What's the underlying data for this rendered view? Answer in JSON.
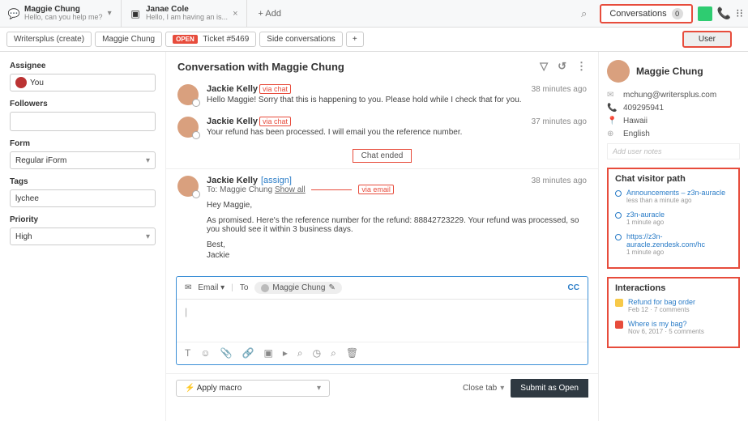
{
  "tabs": [
    {
      "title": "Maggie Chung",
      "subtitle": "Hello, can you help me?"
    },
    {
      "title": "Janae Cole",
      "subtitle": "Hello, I am having an is..."
    }
  ],
  "addTab": "+ Add",
  "topRight": {
    "conversations": "Conversations",
    "conv_count": "0"
  },
  "crumbs": {
    "org": "Writersplus (create)",
    "requester": "Maggie Chung",
    "status": "OPEN",
    "ticket": "Ticket #5469",
    "side": "Side conversations",
    "user": "User"
  },
  "left": {
    "assignee_label": "Assignee",
    "assignee_value": "You",
    "followers_label": "Followers",
    "form_label": "Form",
    "form_value": "Regular iForm",
    "tags_label": "Tags",
    "tags_value": "lychee",
    "priority_label": "Priority",
    "priority_value": "High"
  },
  "conversation": {
    "title": "Conversation with Maggie Chung",
    "messages": [
      {
        "author": "Jackie Kelly",
        "via": "via chat",
        "time": "38 minutes ago",
        "text": "Hello Maggie! Sorry that this is happening to you. Please hold while I check that for you."
      },
      {
        "author": "Jackie Kelly",
        "via": "via chat",
        "time": "37 minutes ago",
        "text": "Your refund has been processed. I will email you the reference number."
      }
    ],
    "chat_ended": "Chat ended",
    "email": {
      "author": "Jackie Kelly",
      "assign": "[assign]",
      "to_label": "To:",
      "to_name": "Maggie Chung",
      "show_all": "Show all",
      "via": "via email",
      "time": "38 minutes ago",
      "greeting": "Hey Maggie,",
      "body": "As promised. Here's the reference number for the refund: 88842723229. Your refund was processed, so you should see it within 3 business days.",
      "signoff": "Best,",
      "signer": "Jackie"
    }
  },
  "composer": {
    "channel": "Email",
    "to_label": "To",
    "recipient": "Maggie Chung",
    "cc": "CC",
    "cursor": "|"
  },
  "bottom": {
    "macro": "Apply macro",
    "close": "Close tab",
    "submit": "Submit as Open"
  },
  "profile": {
    "name": "Maggie Chung",
    "email": "mchung@writersplus.com",
    "phone": "409295941",
    "location": "Hawaii",
    "language": "English",
    "notes_placeholder": "Add user notes"
  },
  "visitor": {
    "heading": "Chat visitor path",
    "items": [
      {
        "title": "Announcements – z3n-auracle",
        "time": "less than a minute ago"
      },
      {
        "title": "z3n-auracle",
        "time": "1 minute ago"
      },
      {
        "title": "https://z3n-auracle.zendesk.com/hc",
        "time": "1 minute ago"
      }
    ]
  },
  "interactions": {
    "heading": "Interactions",
    "items": [
      {
        "color": "#f7c948",
        "title": "Refund for bag order",
        "sub": "Feb 12 · 7 comments"
      },
      {
        "color": "#e74c3c",
        "title": "Where is my bag?",
        "sub": "Nov 6, 2017 · 5 comments"
      }
    ]
  }
}
